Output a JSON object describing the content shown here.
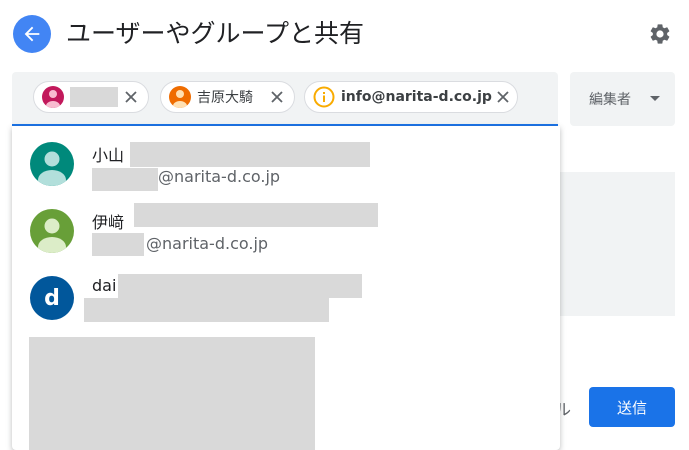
{
  "header": {
    "title": "ユーザーやグループと共有",
    "back_icon": "arrow-back-icon",
    "settings_icon": "gear-icon"
  },
  "recipients": {
    "chips": [
      {
        "label": "",
        "avatar_color": "#c2185b",
        "redacted": true
      },
      {
        "label": "吉原大騎",
        "avatar_color": "#ef6c00",
        "redacted": false
      },
      {
        "label": "info@narita-d.co.jp",
        "icon": "info-icon",
        "redacted": false
      }
    ]
  },
  "role": {
    "label": "編集者"
  },
  "suggestions": [
    {
      "name": "小山",
      "email_suffix": "@narita-d.co.jp",
      "avatar_color": "#00897b"
    },
    {
      "name": "伊﨑",
      "email_suffix": "@narita-d.co.jp",
      "avatar_color": "#689f38"
    },
    {
      "name": "dai",
      "email_suffix": "",
      "avatar_letter": "d",
      "avatar_color": "#01579b"
    }
  ],
  "footer": {
    "cancel_partial": "ル",
    "send_label": "送信"
  },
  "colors": {
    "accent": "#1a73e8",
    "back_button": "#4285f4"
  }
}
